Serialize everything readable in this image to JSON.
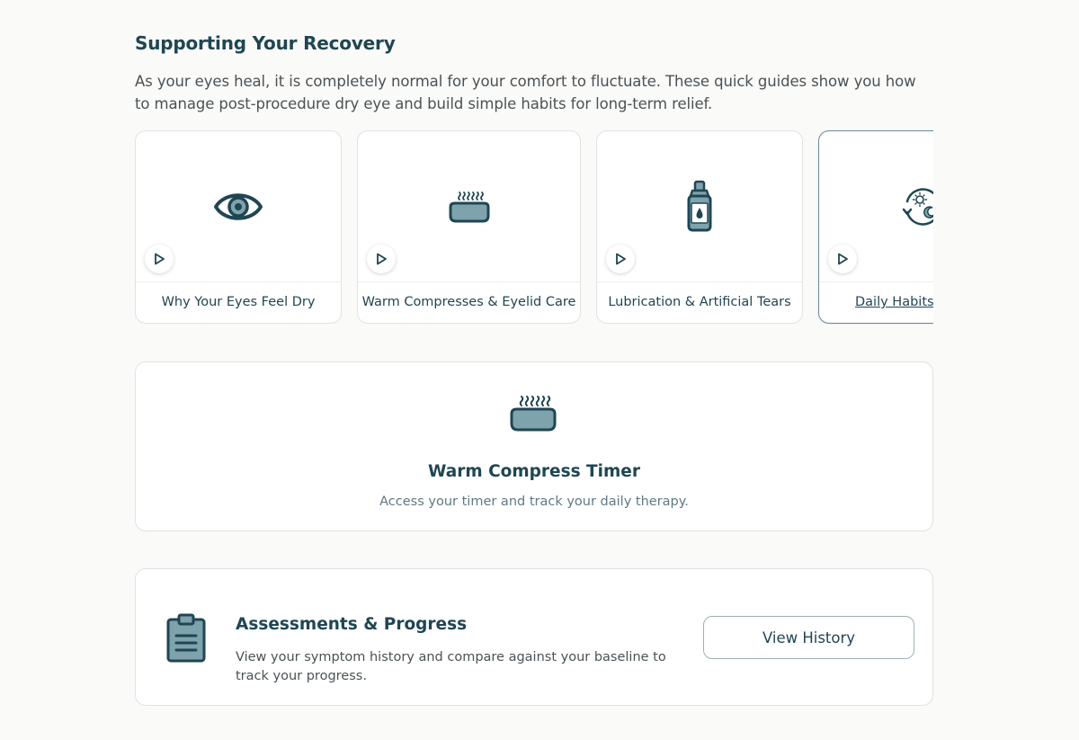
{
  "section": {
    "title": "Supporting Your Recovery",
    "intro": "As your eyes heal, it is completely normal for your comfort to fluctuate. These quick guides show you how to manage post-procedure dry eye and build simple habits for long-term relief."
  },
  "guides": [
    {
      "label": "Why Your Eyes Feel Dry",
      "icon": "eye-icon"
    },
    {
      "label": "Warm Compresses & Eyelid Care",
      "icon": "warm-compress-icon"
    },
    {
      "label": "Lubrication & Artificial Tears",
      "icon": "eye-drop-bottle-icon"
    },
    {
      "label": "Daily Habits T",
      "icon": "day-night-cycle-icon"
    }
  ],
  "timer": {
    "title": "Warm Compress Timer",
    "subtitle": "Access your timer and track your daily therapy.",
    "icon": "warm-compress-icon"
  },
  "assessments": {
    "title": "Assessments & Progress",
    "description": "View your symptom history and compare against your baseline to track your progress.",
    "button_label": "View History",
    "icon": "clipboard-icon"
  },
  "colors": {
    "primary": "#1f4652",
    "accent_fill": "#7fa3ac",
    "background": "#fafaf8"
  }
}
